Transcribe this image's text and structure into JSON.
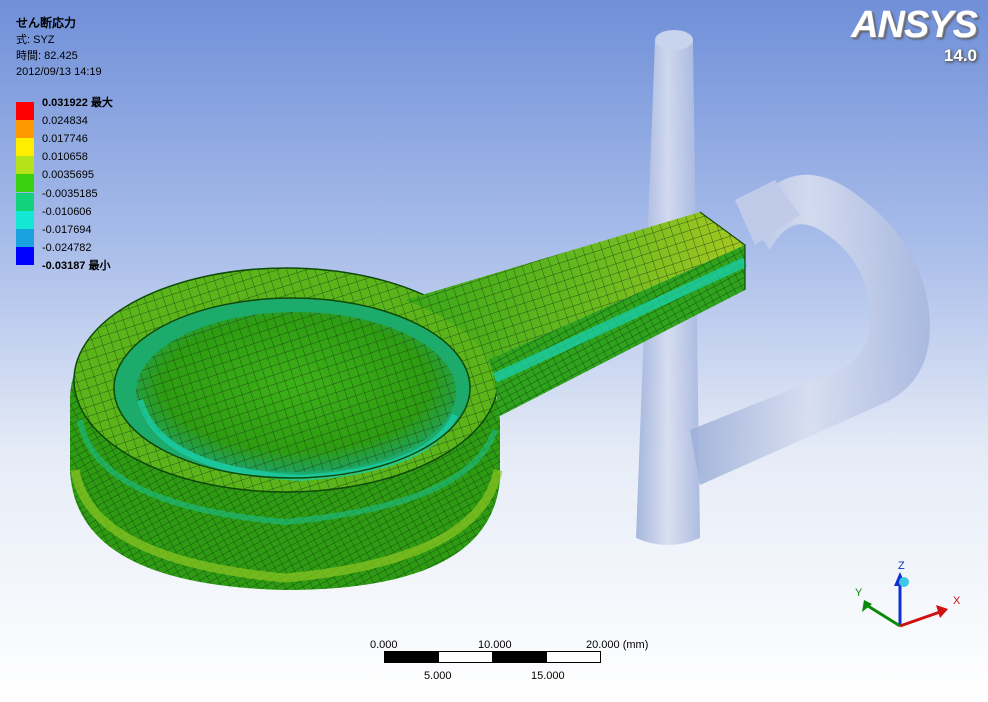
{
  "result": {
    "title": "せん断応力",
    "expression": "式: SYZ",
    "time": "時間: 82.425",
    "date": "2012/09/13 14:19"
  },
  "legend": {
    "entries": [
      {
        "value": "0.031922 最大",
        "color": "#ff0000",
        "bold": true
      },
      {
        "value": "0.024834",
        "color": "#ff9900"
      },
      {
        "value": "0.017746",
        "color": "#ffee00"
      },
      {
        "value": "0.010658",
        "color": "#b5e31b"
      },
      {
        "value": "0.0035695",
        "color": "#3ad10e"
      },
      {
        "value": "-0.0035185",
        "color": "#12d27a"
      },
      {
        "value": "-0.010606",
        "color": "#14e7d4"
      },
      {
        "value": "-0.017694",
        "color": "#1aa2e0"
      },
      {
        "value": "-0.024782",
        "color": "#0033ee"
      },
      {
        "value": "-0.03187 最小",
        "color": "#0000ff",
        "bold": true
      }
    ]
  },
  "logo": {
    "brand": "ANSYS",
    "version": "14.0"
  },
  "scale_bar": {
    "top_labels": [
      "0.000",
      "10.000",
      "20.000 (mm)"
    ],
    "bottom_labels": [
      "5.000",
      "15.000"
    ]
  },
  "triad": {
    "x_label": "X",
    "y_label": "Y",
    "z_label": "Z"
  },
  "colors": {
    "mesh_green": "#2f9e12",
    "mesh_yellow_green": "#8fc722",
    "mesh_cyan": "#1bbf8a",
    "ghost_body": "#b7c6e6",
    "axis_x": "#d01010",
    "axis_y": "#0a8a0a",
    "axis_z": "#1030d0"
  }
}
